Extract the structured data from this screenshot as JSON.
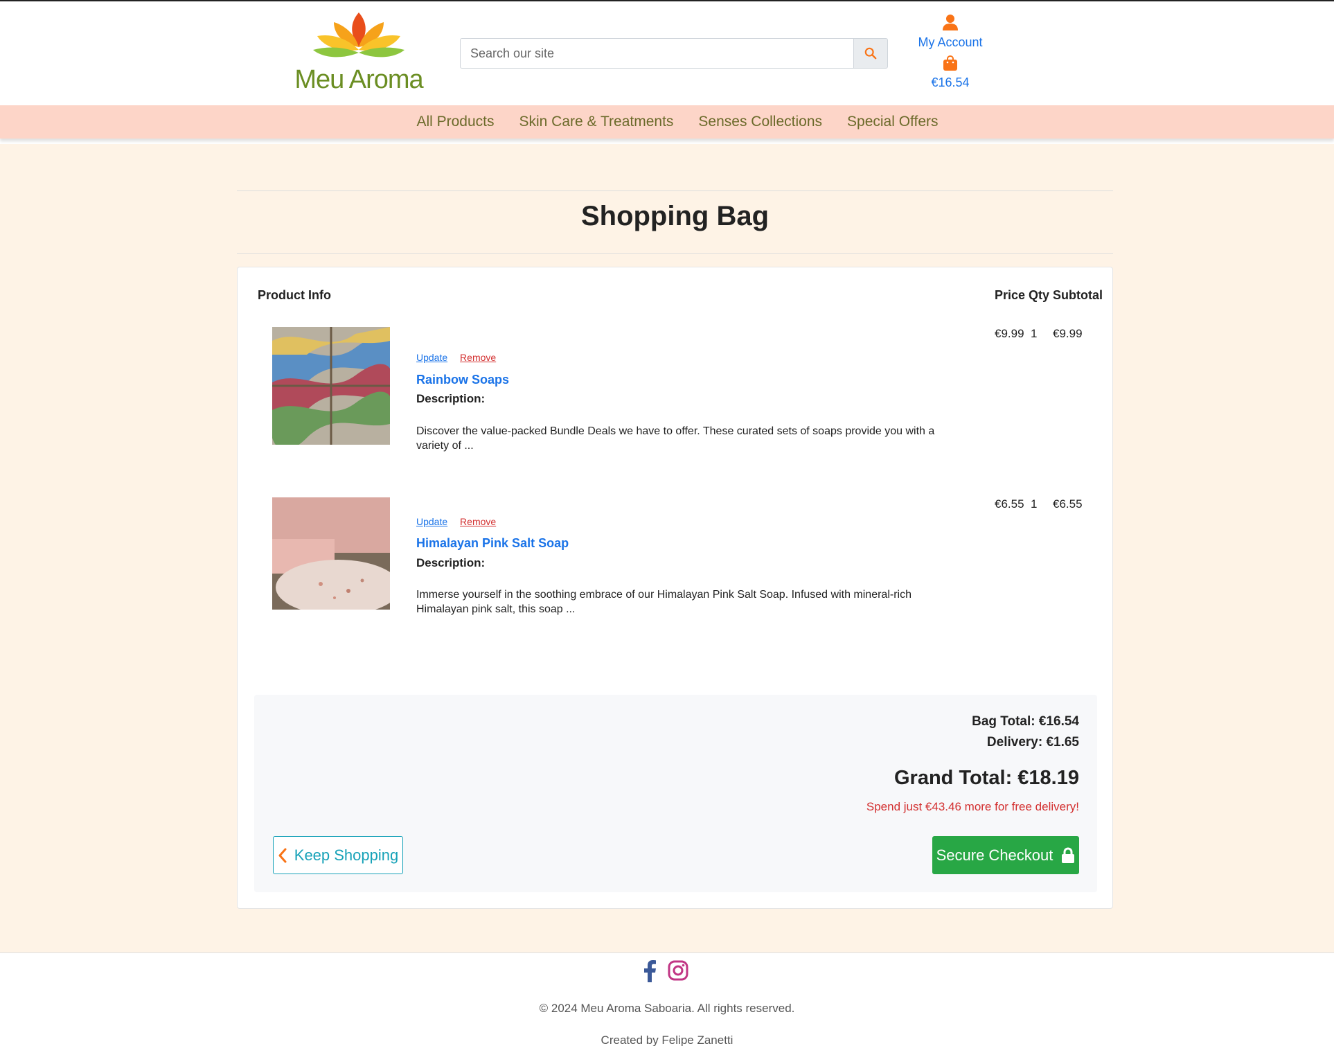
{
  "brand": {
    "name": "Meu Aroma"
  },
  "search": {
    "placeholder": "Search our site"
  },
  "account": {
    "label": "My Account",
    "bag_total": "€16.54"
  },
  "nav": [
    {
      "label": "All Products"
    },
    {
      "label": "Skin Care & Treatments"
    },
    {
      "label": "Senses Collections"
    },
    {
      "label": "Special Offers"
    }
  ],
  "page": {
    "title": "Shopping Bag"
  },
  "table": {
    "headers": {
      "product": "Product Info",
      "price": "Price",
      "qty": "Qty",
      "subtotal": "Subtotal"
    },
    "update_label": "Update",
    "remove_label": "Remove",
    "description_label": "Description:",
    "items": [
      {
        "name": "Rainbow Soaps",
        "description": "Discover the value-packed Bundle Deals we have to offer. These curated sets of soaps provide you with a variety of ...",
        "price": "€9.99",
        "qty": "1",
        "subtotal": "€9.99"
      },
      {
        "name": "Himalayan Pink Salt Soap",
        "description": "Immerse yourself in the soothing embrace of our Himalayan Pink Salt Soap. Infused with mineral-rich Himalayan pink salt, this soap ...",
        "price": "€6.55",
        "qty": "1",
        "subtotal": "€6.55"
      }
    ]
  },
  "summary": {
    "bag_total": "Bag Total: €16.54",
    "delivery": "Delivery: €1.65",
    "grand_total": "Grand Total: €18.19",
    "free_delivery_note": "Spend just €43.46 more for free delivery!",
    "keep_shopping": "Keep Shopping",
    "secure_checkout": "Secure Checkout"
  },
  "footer": {
    "copyright": "© 2024 Meu Aroma Saboaria. All rights reserved.",
    "credit": "Created by Felipe Zanetti"
  },
  "colors": {
    "accent_orange": "#f97316",
    "link_blue": "#1a73e8",
    "nav_bg": "#fdd5c8",
    "page_bg": "#fef3e6",
    "checkout_green": "#28a745",
    "keep_teal": "#17a2b8",
    "danger_red": "#d32f2f"
  }
}
